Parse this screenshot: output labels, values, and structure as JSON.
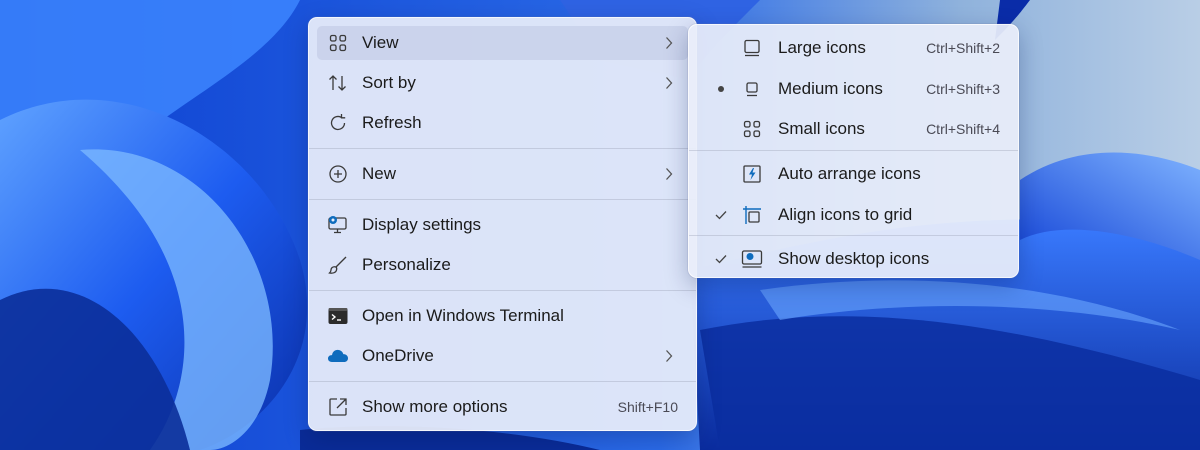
{
  "context_menu": {
    "items": [
      {
        "label": "View",
        "icon": "grid-icon",
        "has_submenu": true
      },
      {
        "label": "Sort by",
        "icon": "sort-arrows-icon",
        "has_submenu": true
      },
      {
        "label": "Refresh",
        "icon": "refresh-icon"
      },
      {
        "label": "New",
        "icon": "plus-circle-icon",
        "has_submenu": true
      },
      {
        "label": "Display settings",
        "icon": "display-settings-icon"
      },
      {
        "label": "Personalize",
        "icon": "brush-icon"
      },
      {
        "label": "Open in Windows Terminal",
        "icon": "terminal-icon"
      },
      {
        "label": "OneDrive",
        "icon": "cloud-icon",
        "has_submenu": true
      },
      {
        "label": "Show more options",
        "icon": "expand-icon",
        "shortcut": "Shift+F10"
      }
    ]
  },
  "view_submenu": {
    "items": [
      {
        "label": "Large icons",
        "icon": "large-icons-icon",
        "shortcut": "Ctrl+Shift+2",
        "state": "none"
      },
      {
        "label": "Medium icons",
        "icon": "medium-icons-icon",
        "shortcut": "Ctrl+Shift+3",
        "state": "selected"
      },
      {
        "label": "Small icons",
        "icon": "small-icons-icon",
        "shortcut": "Ctrl+Shift+4",
        "state": "none"
      },
      {
        "label": "Auto arrange icons",
        "icon": "auto-arrange-icon",
        "state": "unchecked"
      },
      {
        "label": "Align icons to grid",
        "icon": "align-grid-icon",
        "state": "checked"
      },
      {
        "label": "Show desktop icons",
        "icon": "show-desktop-icon",
        "state": "checked"
      }
    ]
  },
  "colors": {
    "accent": "#0f6cbd",
    "wallpaper_blue": "#1a4fd8",
    "menu_background": "#eaeefa"
  }
}
